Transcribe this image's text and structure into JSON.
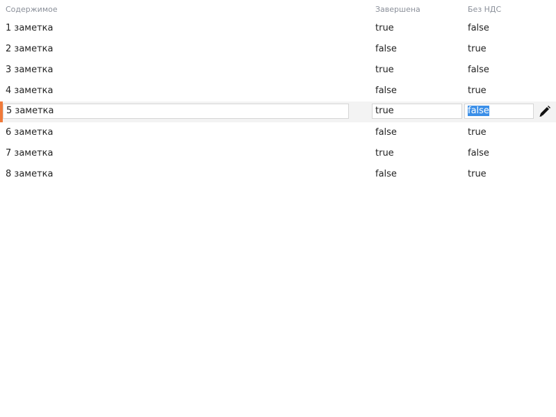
{
  "columns": {
    "content": "Содержимое",
    "completed": "Завершена",
    "no_vat": "Без НДС"
  },
  "rows": [
    {
      "content": "1 заметка",
      "completed": "true",
      "no_vat": "false"
    },
    {
      "content": "2 заметка",
      "completed": "false",
      "no_vat": "true"
    },
    {
      "content": "3 заметка",
      "completed": "true",
      "no_vat": "false"
    },
    {
      "content": "4 заметка",
      "completed": "false",
      "no_vat": "true"
    },
    {
      "content": "5 заметка",
      "completed": "true",
      "no_vat": "false",
      "editing": true
    },
    {
      "content": "6 заметка",
      "completed": "false",
      "no_vat": "true"
    },
    {
      "content": "7 заметка",
      "completed": "true",
      "no_vat": "false"
    },
    {
      "content": "8 заметка",
      "completed": "false",
      "no_vat": "true"
    }
  ],
  "colors": {
    "edit_marker": "#f07a3a",
    "selection": "#3b8fe8",
    "header_text": "#8a8f99"
  },
  "icons": {
    "edit": "pencil-icon"
  }
}
